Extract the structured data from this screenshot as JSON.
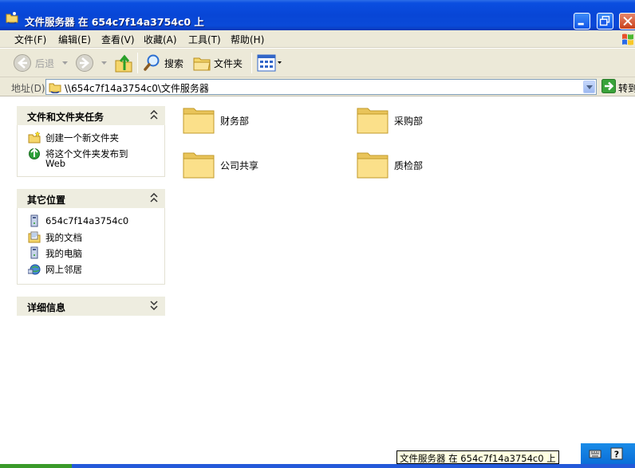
{
  "window": {
    "title": "文件服务器 在 654c7f14a3754c0 上"
  },
  "menu": [
    {
      "label": "文件(F)"
    },
    {
      "label": "编辑(E)"
    },
    {
      "label": "查看(V)"
    },
    {
      "label": "收藏(A)"
    },
    {
      "label": "工具(T)"
    },
    {
      "label": "帮助(H)"
    }
  ],
  "toolbar": {
    "back_label": "后退",
    "search_label": "搜索",
    "folders_label": "文件夹"
  },
  "address": {
    "label": "地址(D)",
    "value": "\\\\654c7f14a3754c0\\文件服务器",
    "go_label": "转到"
  },
  "panels": {
    "tasks": {
      "title": "文件和文件夹任务",
      "items": [
        {
          "label": "创建一个新文件夹",
          "icon": "new-folder-icon"
        },
        {
          "label": "将这个文件夹发布到",
          "label2": "Web",
          "icon": "publish-web-icon"
        }
      ]
    },
    "places": {
      "title": "其它位置",
      "items": [
        {
          "label": "654c7f14a3754c0",
          "icon": "computer-icon"
        },
        {
          "label": "我的文档",
          "icon": "my-documents-icon"
        },
        {
          "label": "我的电脑",
          "icon": "my-computer-icon"
        },
        {
          "label": "网上邻居",
          "icon": "network-icon"
        }
      ]
    },
    "details": {
      "title": "详细信息"
    }
  },
  "folders": [
    {
      "name": "财务部"
    },
    {
      "name": "采购部"
    },
    {
      "name": "公司共享"
    },
    {
      "name": "质检部"
    }
  ],
  "tooltip": {
    "text": "文件服务器 在 654c7f14a3754c0 上"
  },
  "colors": {
    "titlebar": "#0a4ee0",
    "panel_header": "#eeede0",
    "folder_yellow": "#f6d36a"
  }
}
